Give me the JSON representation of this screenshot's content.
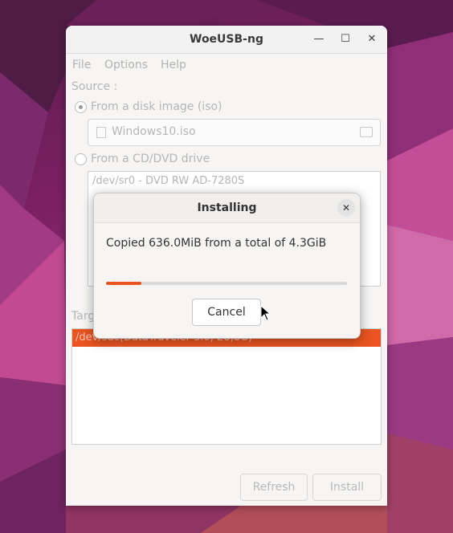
{
  "window": {
    "title": "WoeUSB-ng",
    "controls": {
      "minimize": "—",
      "maximize": "☐",
      "close": "✕"
    }
  },
  "menu": [
    "File",
    "Options",
    "Help"
  ],
  "source": {
    "label": "Source :",
    "disk_image_label": "From a disk image (iso)",
    "iso_file": "Windows10.iso",
    "cd_label": "From a CD/DVD drive",
    "cd_drive": "/dev/sr0 - DVD RW AD-7280S"
  },
  "target": {
    "label_visible": "Targ",
    "selected_device": "/dev/sdc(DataTraveler 3.0, 28,8G)"
  },
  "buttons": {
    "refresh": "Refresh",
    "install": "Install"
  },
  "dialog": {
    "title": "Installing",
    "message": "Copied 636.0MiB from a total of 4.3GiB",
    "progress_fraction": 0.146,
    "cancel_label": "Cancel",
    "close_glyph": "✕"
  },
  "colors": {
    "accent": "#e95420"
  }
}
